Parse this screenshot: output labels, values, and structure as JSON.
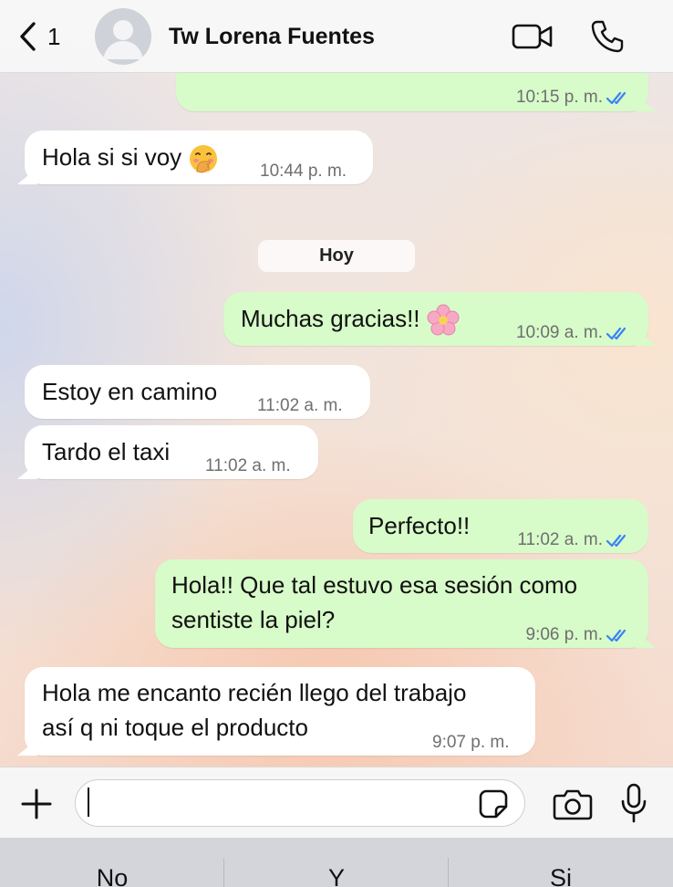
{
  "header": {
    "back_count": "1",
    "contact_name": "Tw Lorena Fuentes",
    "icons": [
      "chevron-left-icon",
      "avatar-placeholder",
      "video-call-icon",
      "phone-icon"
    ]
  },
  "day_separator": "Hoy",
  "messages": [
    {
      "direction": "outgoing",
      "text": "",
      "time": "10:15 p. m.",
      "status": "read"
    },
    {
      "direction": "incoming",
      "text": "Hola si si voy",
      "emoji": "face-with-hand-over-mouth",
      "time": "10:44 p. m."
    },
    {
      "direction": "outgoing",
      "text": "Muchas gracias!!",
      "emoji": "cherry-blossom",
      "time": "10:09 a. m.",
      "status": "read"
    },
    {
      "direction": "incoming",
      "text": "Estoy en camino",
      "time": "11:02 a. m."
    },
    {
      "direction": "incoming",
      "text": "Tardo el taxi",
      "time": "11:02 a. m."
    },
    {
      "direction": "outgoing",
      "text": "Perfecto!!",
      "time": "11:02 a. m.",
      "status": "read"
    },
    {
      "direction": "outgoing",
      "lines": [
        "Hola!! Que tal estuvo esa sesión como",
        "sentiste la piel?"
      ],
      "time": "9:06 p. m.",
      "status": "read"
    },
    {
      "direction": "incoming",
      "lines": [
        "Hola me encanto recién llego del trabajo",
        "así q ni toque el producto"
      ],
      "time": "9:07 p. m."
    }
  ],
  "composer": {
    "input_value": "",
    "icons": [
      "plus-icon",
      "sticker-icon",
      "camera-icon",
      "microphone-icon"
    ]
  },
  "keyboard_suggestions": [
    "No",
    "Y",
    "Si"
  ],
  "colors": {
    "outgoing_bubble": "#d7fbc9",
    "incoming_bubble": "#ffffff",
    "read_tick": "#3b82f6"
  }
}
